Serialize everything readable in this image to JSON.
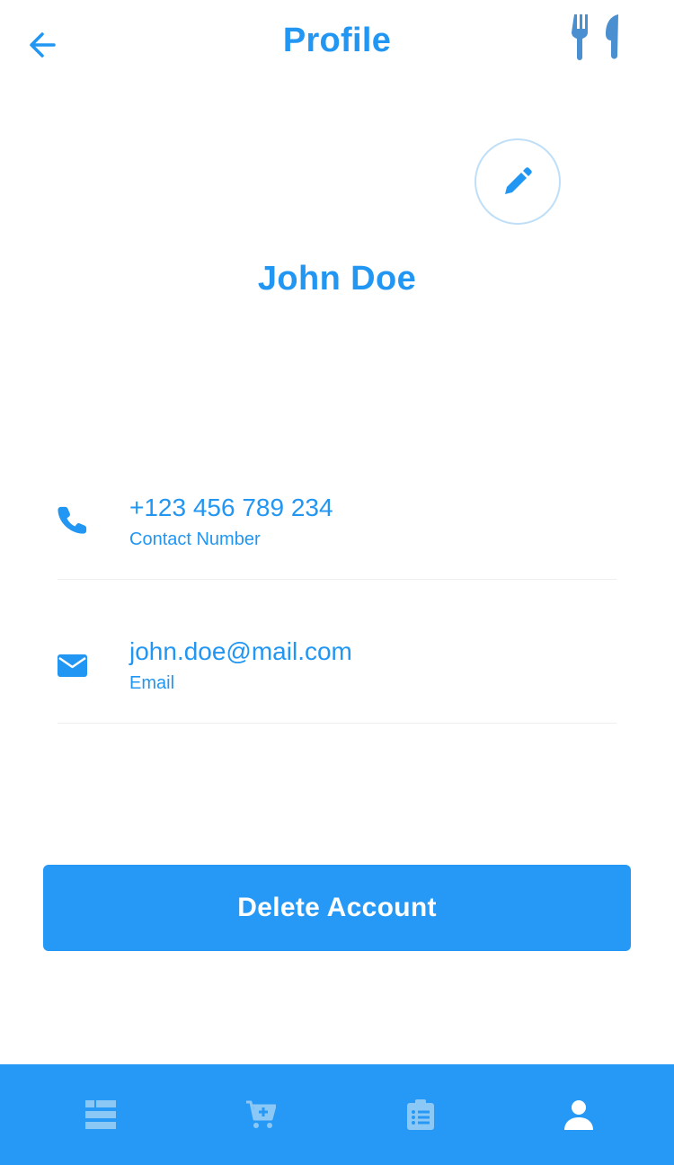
{
  "header": {
    "title": "Profile",
    "back_icon": "arrow-left-icon",
    "right_icon": "fork-knife-icon"
  },
  "profile": {
    "name": "John Doe",
    "edit_icon": "pencil-icon"
  },
  "contact": {
    "phone": {
      "value": "+123 456 789 234",
      "label": "Contact Number",
      "icon": "phone-icon"
    },
    "email": {
      "value": "john.doe@mail.com",
      "label": "Email",
      "icon": "envelope-icon"
    }
  },
  "actions": {
    "delete_label": "Delete Account"
  },
  "nav": {
    "items": [
      {
        "icon": "dashboard-icon",
        "active": false
      },
      {
        "icon": "cart-plus-icon",
        "active": false
      },
      {
        "icon": "clipboard-list-icon",
        "active": false
      },
      {
        "icon": "user-icon",
        "active": true
      }
    ]
  },
  "colors": {
    "primary": "#2196f3",
    "nav_bg": "#2699f7",
    "nav_inactive": "#8cc8f5",
    "nav_active": "#ffffff"
  }
}
